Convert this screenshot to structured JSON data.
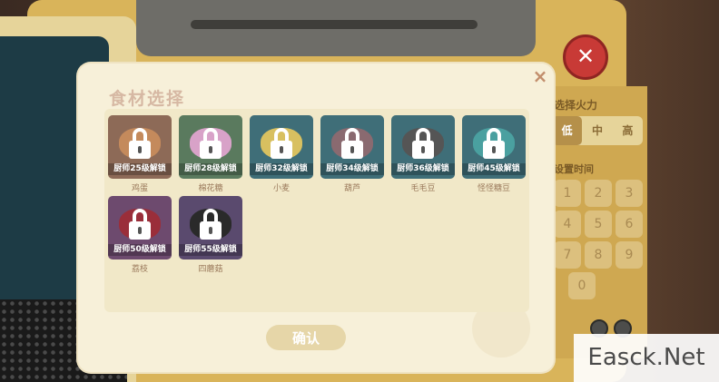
{
  "dialog": {
    "title": "食材选择",
    "close_symbol": "×",
    "confirm_label": "确认"
  },
  "background": {
    "fire_label": "选择火力",
    "fire_options": [
      "低",
      "中",
      "高"
    ],
    "time_label": "设置时间",
    "keypad": [
      "1",
      "2",
      "3",
      "4",
      "5",
      "6",
      "7",
      "8",
      "9",
      "0"
    ],
    "close_symbol": "✕"
  },
  "items": [
    {
      "name": "鸡蛋",
      "unlock": "厨师25级解锁",
      "color": "#8d6a57",
      "blob": "#c48a5c",
      "icon": "egg-icon"
    },
    {
      "name": "棉花糖",
      "unlock": "厨师28级解锁",
      "color": "#5a7a5e",
      "blob": "#d8a2c8",
      "icon": "marshmallow-icon"
    },
    {
      "name": "小麦",
      "unlock": "厨师32级解锁",
      "color": "#3f6e78",
      "blob": "#d8c060",
      "icon": "wheat-icon"
    },
    {
      "name": "葫芦",
      "unlock": "厨师34级解锁",
      "color": "#3f6e78",
      "blob": "#8a6a70",
      "icon": "gourd-icon"
    },
    {
      "name": "毛毛豆",
      "unlock": "厨师36级解锁",
      "color": "#3f6e78",
      "blob": "#555555",
      "icon": "edamame-icon"
    },
    {
      "name": "怪怪糖豆",
      "unlock": "厨师45级解锁",
      "color": "#3f6e78",
      "blob": "#4aa0a0",
      "icon": "candy-icon"
    },
    {
      "name": "荔枝",
      "unlock": "厨师50级解锁",
      "color": "#6d4a6e",
      "blob": "#9a2e3a",
      "icon": "lychee-icon"
    },
    {
      "name": "四蘑菇",
      "unlock": "厨师55级解锁",
      "color": "#5a4a6e",
      "blob": "#2a2a2a",
      "icon": "mushroom-icon"
    }
  ],
  "watermark": "Easck.Net"
}
